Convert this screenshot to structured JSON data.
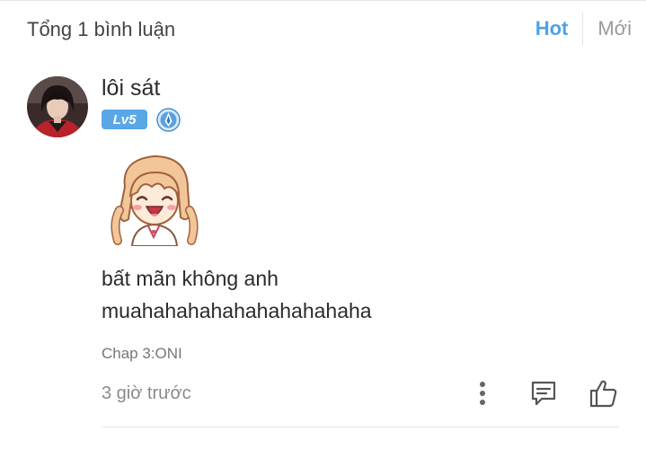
{
  "header": {
    "total_label": "Tổng 1 bình luận",
    "sort_hot": "Hot",
    "sort_new": "Mới"
  },
  "comment": {
    "username": "lôi sát",
    "level": "Lv5",
    "avatar_icon": "user-avatar",
    "rank_icon": "rank-emblem-icon",
    "sticker_icon": "laughing-girl-sticker",
    "text_lines": [
      "bất mãn không anh",
      "muahahahahahahahahahaha"
    ],
    "chapter": "Chap 3:ONI",
    "time": "3 giờ trước"
  },
  "colors": {
    "accent": "#4fa3e6",
    "level_badge": "#5aa7e8",
    "muted": "#9a9a9a"
  }
}
